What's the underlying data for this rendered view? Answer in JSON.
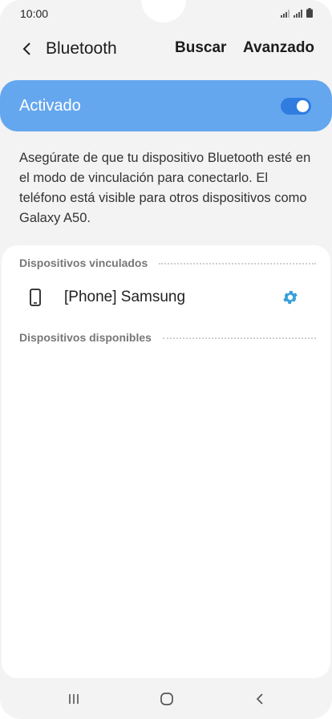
{
  "status_bar": {
    "time": "10:00"
  },
  "app_bar": {
    "title": "Bluetooth",
    "search_label": "Buscar",
    "advanced_label": "Avanzado"
  },
  "toggle": {
    "label": "Activado",
    "state": "on"
  },
  "description": "Asegúrate de que tu dispositivo Bluetooth esté en el modo de vinculación para conectarlo. El teléfono está visible para otros dispositivos como Galaxy A50.",
  "paired_section": {
    "header": "Dispositivos vinculados",
    "devices": [
      {
        "name": "[Phone] Samsung",
        "icon": "phone-icon"
      }
    ]
  },
  "available_section": {
    "header": "Dispositivos disponibles"
  },
  "colors": {
    "accent": "#65a7ef",
    "switch_on": "#2f7de0",
    "gear": "#3aa0d8",
    "background": "#f3f3f3"
  },
  "nav_bar": {
    "icons": [
      "recent-apps-icon",
      "home-icon",
      "back-icon"
    ]
  }
}
